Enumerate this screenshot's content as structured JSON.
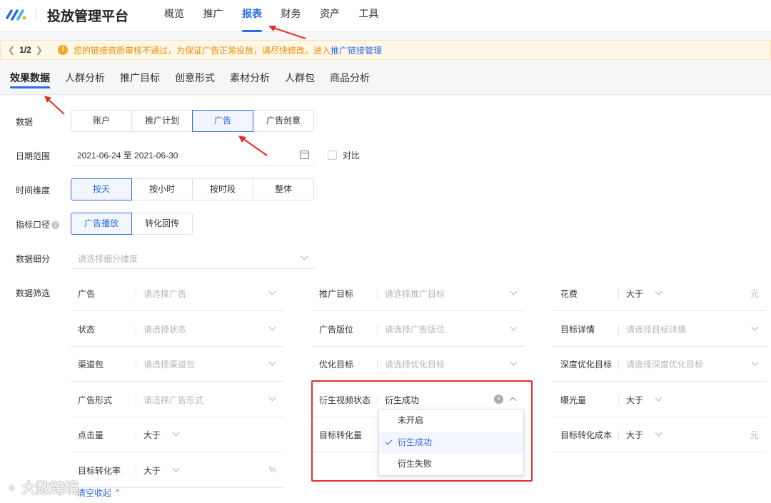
{
  "header": {
    "app_title": "投放管理平台",
    "nav": [
      "概览",
      "推广",
      "报表",
      "财务",
      "资产",
      "工具"
    ],
    "active_nav": "报表"
  },
  "notice": {
    "pager": "1/2",
    "message": "您的链接资质审核不通过，为保证广告正常投放，请尽快修改。进入",
    "link": "推广链接管理"
  },
  "subtabs": [
    "效果数据",
    "人群分析",
    "推广目标",
    "创意形式",
    "素材分析",
    "人群包",
    "商品分析"
  ],
  "form": {
    "data_label": "数据",
    "data_options": [
      "账户",
      "推广计划",
      "广告",
      "广告创意"
    ],
    "data_selected": "广告",
    "date_label": "日期范围",
    "date_value": "2021-06-24 至 2021-06-30",
    "compare_label": "对比",
    "time_label": "时间维度",
    "time_options": [
      "按天",
      "按小时",
      "按时段",
      "整体"
    ],
    "time_selected": "按天",
    "metric_label": "指标口径",
    "metric_help": "?",
    "metric_options": [
      "广告播放",
      "转化回传"
    ],
    "metric_selected": "广告播放",
    "breakdown_label": "数据细分",
    "breakdown_placeholder": "请选择细分维度",
    "filter_label": "数据筛选"
  },
  "filters": {
    "ad": {
      "label": "广告",
      "placeholder": "请选择广告"
    },
    "goal": {
      "label": "推广目标",
      "placeholder": "请选择推广目标"
    },
    "cost": {
      "label": "花费",
      "op": "大于",
      "unit": "元"
    },
    "status": {
      "label": "状态",
      "placeholder": "请选择状态"
    },
    "placement": {
      "label": "广告版位",
      "placeholder": "请选择广告版位"
    },
    "target_detail": {
      "label": "目标详情",
      "placeholder": "请选择目标详情"
    },
    "channel": {
      "label": "渠道包",
      "placeholder": "请选择渠道包"
    },
    "optimize": {
      "label": "优化目标",
      "placeholder": "请选择优化目标"
    },
    "deep_optimize": {
      "label": "深度优化目标",
      "placeholder": "请选择深度优化目标"
    },
    "ad_format": {
      "label": "广告形式",
      "placeholder": "请选择广告形式"
    },
    "derived_video": {
      "label": "衍生视频状态",
      "value": "衍生成功",
      "clear": "×"
    },
    "impressions": {
      "label": "曝光量",
      "op": "大于"
    },
    "clicks": {
      "label": "点击量",
      "op": "大于"
    },
    "target_conversions": {
      "label": "目标转化量"
    },
    "target_cost": {
      "label": "目标转化成本",
      "op": "大于",
      "unit": "元"
    },
    "target_rate": {
      "label": "目标转化率",
      "op": "大于",
      "unit": "%"
    }
  },
  "dropdown": {
    "options": [
      "未开启",
      "衍生成功",
      "衍生失败"
    ],
    "selected": "衍生成功"
  },
  "collapse": {
    "clear_partial": "清空",
    "label": "收起"
  },
  "watermark": "大数跨境",
  "colors": {
    "accent": "#2f6be4",
    "warning": "#f08c00",
    "highlight": "#e0302d"
  }
}
